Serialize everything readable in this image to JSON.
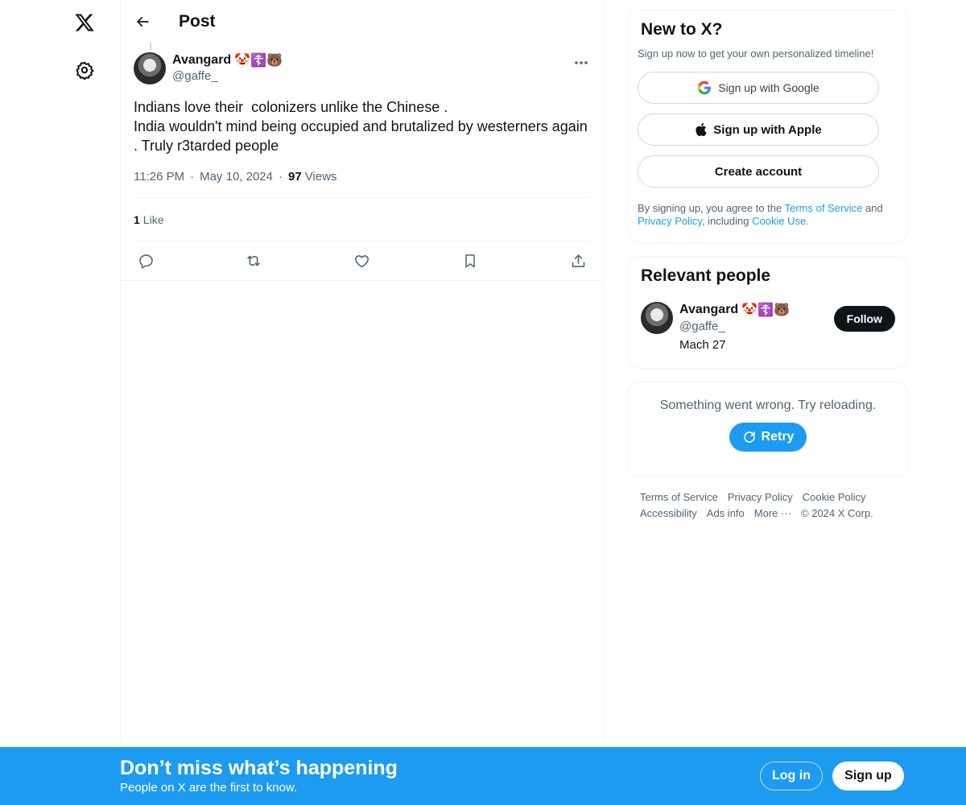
{
  "nav": {
    "logo_icon": "x-logo-icon",
    "settings_icon": "gear-icon"
  },
  "header": {
    "title": "Post",
    "back_icon": "arrow-left-icon"
  },
  "post": {
    "author_name": "Avangard",
    "author_emojis": "🤡☦️🐻",
    "handle": "@gaffe_",
    "text": "Indians love their  colonizers unlike the Chinese .\nIndia wouldn't mind being occupied and brutalized by westerners again . Truly r3tarded people",
    "time": "11:26 PM",
    "date": "May 10, 2024",
    "views_count": "97",
    "views_label": "Views",
    "likes_count": "1",
    "likes_label": "Like"
  },
  "signup_card": {
    "title": "New to X?",
    "subtitle": "Sign up now to get your own personalized timeline!",
    "google_label": "Sign up with Google",
    "apple_label": "Sign up with Apple",
    "create_label": "Create account",
    "legal_prefix": "By signing up, you agree to the ",
    "terms_link": "Terms of Service",
    "legal_and": " and ",
    "privacy_link": "Privacy Policy",
    "legal_including": ", including ",
    "cookie_link": "Cookie Use."
  },
  "relevant_people": {
    "title": "Relevant people",
    "name": "Avangard",
    "emojis": "🤡☦️🐻",
    "handle": "@gaffe_",
    "bio": "Mach 27",
    "follow_label": "Follow"
  },
  "error_card": {
    "message": "Something went wrong. Try reloading.",
    "retry_label": "Retry"
  },
  "footer": {
    "terms": "Terms of Service",
    "privacy": "Privacy Policy",
    "cookie": "Cookie Policy",
    "accessibility": "Accessibility",
    "ads": "Ads info",
    "more": "More ···",
    "copyright": "© 2024 X Corp."
  },
  "banner": {
    "title": "Don’t miss what’s happening",
    "subtitle": "People on X are the first to know.",
    "login_label": "Log in",
    "signup_label": "Sign up"
  },
  "colors": {
    "accent": "#1d9bf0",
    "text": "#0f1419",
    "secondary": "#536471",
    "border": "#eff3f4"
  }
}
